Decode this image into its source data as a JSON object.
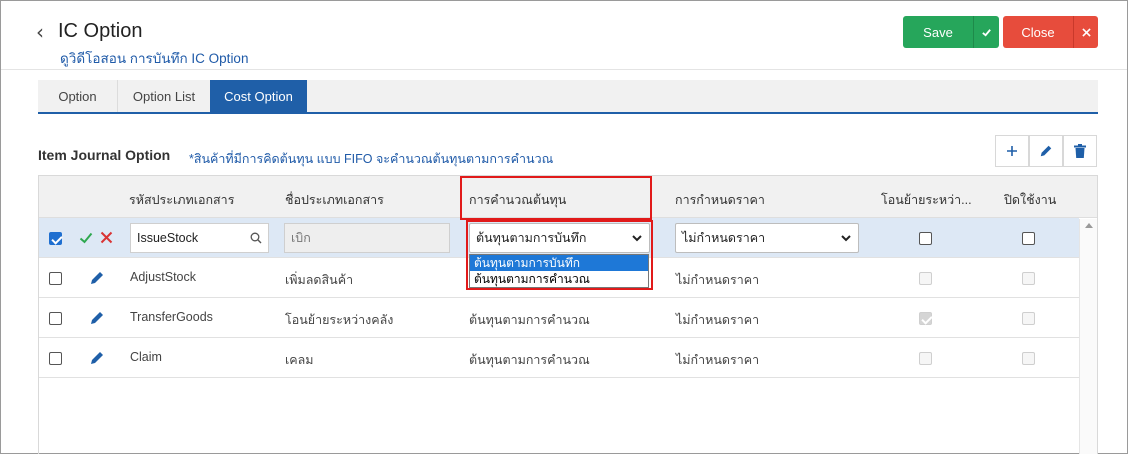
{
  "header": {
    "back_glyph": "‹",
    "title": "IC Option",
    "subtitle": "ดูวิดีโอสอน การบันทึก IC Option",
    "save_label": "Save",
    "close_label": "Close"
  },
  "tabs": [
    {
      "label": "Option",
      "active": false
    },
    {
      "label": "Option List",
      "active": false
    },
    {
      "label": "Cost Option",
      "active": true
    }
  ],
  "section": {
    "title": "Item Journal Option",
    "note": "*สินค้าที่มีการคิดต้นทุน แบบ FIFO จะคำนวณต้นทุนตามการคำนวณ"
  },
  "columns": [
    "รหัสประเภทเอกสาร",
    "ชื่อประเภทเอกสาร",
    "การคำนวณต้นทุน",
    "การกำหนดราคา",
    "โอนย้ายระหว่า...",
    "ปิดใช้งาน"
  ],
  "edit_row": {
    "selected": true,
    "code": "IssueStock",
    "name": "เบิก",
    "cost_calc": "ต้นทุนตามการบันทึก",
    "pricing": "ไม่กำหนดราคา",
    "transfer": false,
    "disabled": false
  },
  "dropdown_options": [
    {
      "label": "ต้นทุนตามการบันทึก",
      "highlighted": true
    },
    {
      "label": "ต้นทุนตามการคำนวณ",
      "highlighted": false
    }
  ],
  "rows": [
    {
      "code": "AdjustStock",
      "name": "เพิ่มลดสินค้า",
      "cost_calc": "",
      "pricing": "ไม่กำหนดราคา",
      "transfer": false,
      "disabled": false
    },
    {
      "code": "TransferGoods",
      "name": "โอนย้ายระหว่างคลัง",
      "cost_calc": "ต้นทุนตามการคำนวณ",
      "pricing": "ไม่กำหนดราคา",
      "transfer": true,
      "disabled": false
    },
    {
      "code": "Claim",
      "name": "เคลม",
      "cost_calc": "ต้นทุนตามการคำนวณ",
      "pricing": "ไม่กำหนดราคา",
      "transfer": false,
      "disabled": false
    }
  ],
  "colors": {
    "primary": "#1f5fa8",
    "save": "#26a65b",
    "close": "#e74c3c",
    "highlight": "#e11a1a",
    "option_active": "#1e78d7"
  }
}
